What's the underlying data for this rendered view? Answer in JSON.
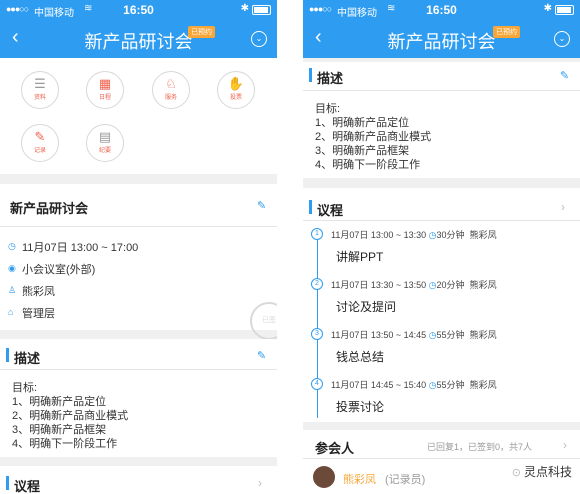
{
  "status": {
    "carrier": "中国移动",
    "time": "16:50"
  },
  "nav": {
    "back": "‹",
    "title": "新产品研讨会",
    "badge": "已预约"
  },
  "functions": [
    {
      "label": "资料",
      "icon": "document-icon",
      "glyph": "☰"
    },
    {
      "label": "日程",
      "icon": "calendar-icon",
      "glyph": "▦"
    },
    {
      "label": "服务",
      "icon": "service-icon",
      "glyph": "♘"
    },
    {
      "label": "投票",
      "icon": "vote-hand-icon",
      "glyph": "✋"
    },
    {
      "label": "记录",
      "icon": "edit-record-icon",
      "glyph": "✎"
    },
    {
      "label": "纪要",
      "icon": "minutes-icon",
      "glyph": "▤"
    }
  ],
  "meeting": {
    "title": "新产品研讨会",
    "time": "11月07日 13:00 ~ 17:00",
    "room": "小会议室(外部)",
    "host": "熊彩凤",
    "group": "管理层",
    "stamp": "已签"
  },
  "description": {
    "heading": "描述",
    "lines": [
      "目标:",
      "1、明确新产品定位",
      "2、明确新产品商业模式",
      "3、明确新产品框架",
      "4、明确下一阶段工作"
    ]
  },
  "agenda": {
    "heading": "议程",
    "items": [
      {
        "num": "1",
        "time": "11月07日 13:00 ~ 13:30",
        "duration": "30分钟",
        "person": "熊彩凤",
        "topic": "讲解PPT"
      },
      {
        "num": "2",
        "time": "11月07日 13:30 ~ 13:50",
        "duration": "20分钟",
        "person": "熊彩凤",
        "topic": "讨论及提问"
      },
      {
        "num": "3",
        "time": "11月07日 13:50 ~ 14:45",
        "duration": "55分钟",
        "person": "熊彩凤",
        "topic": "钱总总结"
      },
      {
        "num": "4",
        "time": "11月07日 14:45 ~ 15:40",
        "duration": "55分钟",
        "person": "熊彩凤",
        "topic": "投票讨论"
      }
    ]
  },
  "participants": {
    "heading": "参会人",
    "summary": "已回复1，已签到0，共7人",
    "first_name": "熊彩凤",
    "first_role": "(记录员)"
  },
  "watermark": "灵点科技"
}
